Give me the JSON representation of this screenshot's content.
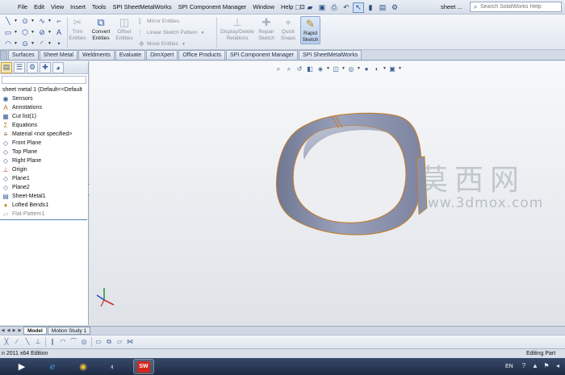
{
  "menu": {
    "items": [
      "File",
      "Edit",
      "View",
      "Insert",
      "Tools",
      "SPI SheetMetalWorks",
      "SPI Component Manager",
      "Window",
      "Help"
    ],
    "pin_glyph": "⊡",
    "document_title": "sheet ...",
    "search_placeholder": "Search SolidWorks Help"
  },
  "ribbon": {
    "trim": "Trim\nEntities",
    "convert": "Convert\nEntities",
    "offset": "Offset\nEntities",
    "mirror": "Mirror Entities",
    "linear_pattern": "Linear Sketch Pattern",
    "move": "Move Entities",
    "display_delete": "Display/Delete\nRelations",
    "repair": "Repair\nSketch",
    "quick_snaps": "Quick\nSnaps",
    "rapid_sketch": "Rapid\nSketch"
  },
  "tabs": [
    "Surfaces",
    "Sheet Metal",
    "Weldments",
    "Evaluate",
    "DimXpert",
    "Office Products",
    "SPI Component Manager",
    "SPI SheetMetalWorks"
  ],
  "tree": {
    "root": "sheet metal 1  (Default<<Default",
    "items": [
      {
        "label": "Sensors",
        "icon": "sensor-icon"
      },
      {
        "label": "Annotations",
        "icon": "annotations-icon"
      },
      {
        "label": "Cut list(1)",
        "icon": "cut-list-icon"
      },
      {
        "label": "Equations",
        "icon": "equations-icon"
      },
      {
        "label": "Material <not specified>",
        "icon": "material-icon"
      },
      {
        "label": "Front Plane",
        "icon": "plane-icon"
      },
      {
        "label": "Top Plane",
        "icon": "plane-icon"
      },
      {
        "label": "Right Plane",
        "icon": "plane-icon"
      },
      {
        "label": "Origin",
        "icon": "origin-icon"
      },
      {
        "label": "Plane1",
        "icon": "plane-icon"
      },
      {
        "label": "Plane2",
        "icon": "plane-icon"
      },
      {
        "label": "Sheet-Metal1",
        "icon": "sheet-metal-icon"
      },
      {
        "label": "Lofted Bends1",
        "icon": "lofted-bends-icon"
      },
      {
        "label": "Flat-Pattern1",
        "icon": "flat-pattern-icon"
      }
    ]
  },
  "watermark": {
    "cn": "莫西网",
    "url": "www.3dmox.com"
  },
  "bottom_tabs": [
    "Model",
    "Motion Study 1"
  ],
  "status": {
    "left": "n 2011 x64 Edition",
    "right": "Editing Part"
  },
  "taskbar": {
    "language": "EN",
    "solidworks_badge": "SW"
  }
}
